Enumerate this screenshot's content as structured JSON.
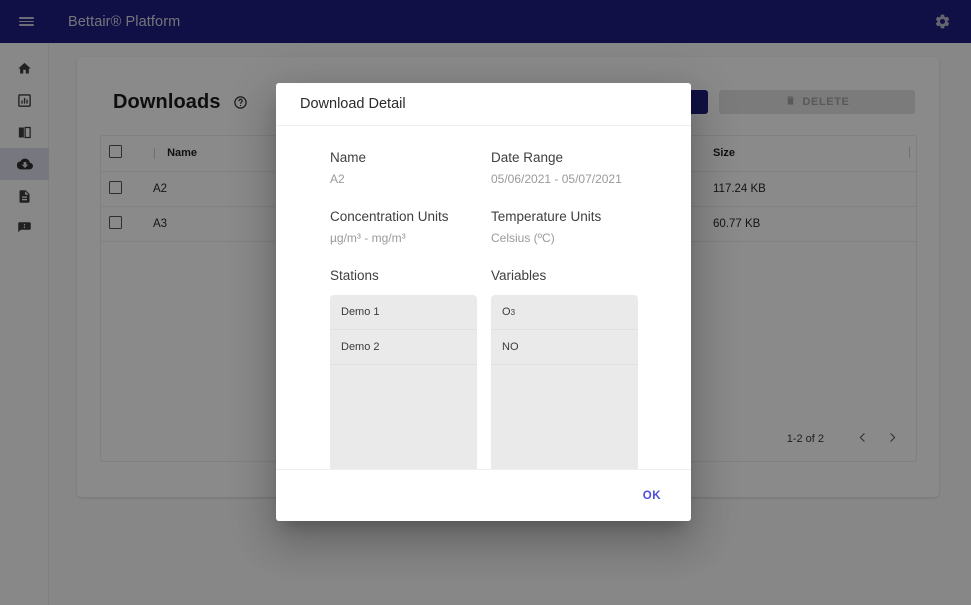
{
  "appbar": {
    "title": "Bettair® Platform",
    "menu_icon": "hamburger-menu-icon",
    "settings_icon": "gear-icon",
    "background_color": "#1f1f82",
    "title_color": "#d6d6e4"
  },
  "sidebar": {
    "items": [
      {
        "icon": "home-icon",
        "name": "home",
        "active": false
      },
      {
        "icon": "bar-chart-icon",
        "name": "analytics",
        "active": false
      },
      {
        "icon": "compare-chart-icon",
        "name": "compare",
        "active": false
      },
      {
        "icon": "cloud-download-icon",
        "name": "downloads",
        "active": true
      },
      {
        "icon": "document-icon",
        "name": "reports",
        "active": false
      },
      {
        "icon": "alert-flag-icon",
        "name": "alerts",
        "active": false
      }
    ],
    "active_background": "#dcdcea"
  },
  "page": {
    "title": "Downloads",
    "help_icon": "help-circle-icon",
    "primary_button_label": "",
    "delete_button": {
      "label": "DELETE",
      "icon": "trash-icon",
      "disabled": true
    },
    "table": {
      "columns": [
        "",
        "Name",
        "",
        "Size"
      ],
      "rows": [
        {
          "name": "A2",
          "size": "117.24 KB",
          "checked": false
        },
        {
          "name": "A3",
          "size": "60.77 KB",
          "checked": false
        }
      ],
      "pagination": {
        "range_label": "1-2 of 2",
        "prev_icon": "chevron-left-icon",
        "next_icon": "chevron-right-icon"
      }
    }
  },
  "dialog": {
    "title": "Download Detail",
    "fields": [
      {
        "label": "Name",
        "value": "A2"
      },
      {
        "label": "Date Range",
        "value": "05/06/2021 - 05/07/2021"
      },
      {
        "label": "Concentration Units",
        "value": "µg/m³ - mg/m³"
      },
      {
        "label": "Temperature Units",
        "value": "Celsius (ºC)"
      }
    ],
    "stations": {
      "label": "Stations",
      "items": [
        "Demo 1",
        "Demo 2"
      ]
    },
    "variables": {
      "label": "Variables",
      "items_html": [
        "O<sub>3</sub>",
        "NO"
      ],
      "items_text": [
        "O3",
        "NO"
      ]
    },
    "ok_label": "OK",
    "ok_color": "#4d4dde"
  },
  "colors": {
    "brand": "#1f1f82",
    "accent": "#21217d",
    "scrim": "rgba(0,0,0,0.46)",
    "listbox": "#eaeaea",
    "disabled_button": "#e3e3e3"
  }
}
